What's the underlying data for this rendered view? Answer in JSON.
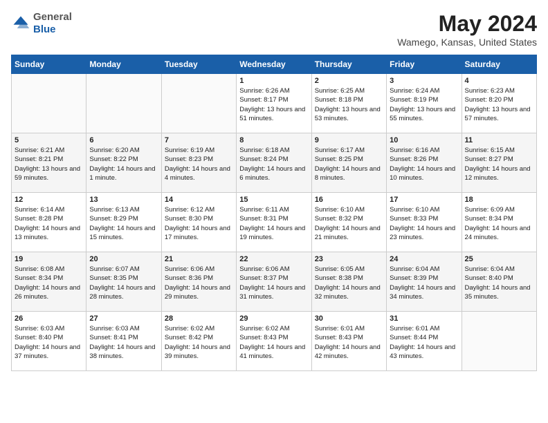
{
  "header": {
    "logo_general": "General",
    "logo_blue": "Blue",
    "month_title": "May 2024",
    "location": "Wamego, Kansas, United States"
  },
  "days_of_week": [
    "Sunday",
    "Monday",
    "Tuesday",
    "Wednesday",
    "Thursday",
    "Friday",
    "Saturday"
  ],
  "weeks": [
    [
      {
        "day": "",
        "sunrise": "",
        "sunset": "",
        "daylight": ""
      },
      {
        "day": "",
        "sunrise": "",
        "sunset": "",
        "daylight": ""
      },
      {
        "day": "",
        "sunrise": "",
        "sunset": "",
        "daylight": ""
      },
      {
        "day": "1",
        "sunrise": "Sunrise: 6:26 AM",
        "sunset": "Sunset: 8:17 PM",
        "daylight": "Daylight: 13 hours and 51 minutes."
      },
      {
        "day": "2",
        "sunrise": "Sunrise: 6:25 AM",
        "sunset": "Sunset: 8:18 PM",
        "daylight": "Daylight: 13 hours and 53 minutes."
      },
      {
        "day": "3",
        "sunrise": "Sunrise: 6:24 AM",
        "sunset": "Sunset: 8:19 PM",
        "daylight": "Daylight: 13 hours and 55 minutes."
      },
      {
        "day": "4",
        "sunrise": "Sunrise: 6:23 AM",
        "sunset": "Sunset: 8:20 PM",
        "daylight": "Daylight: 13 hours and 57 minutes."
      }
    ],
    [
      {
        "day": "5",
        "sunrise": "Sunrise: 6:21 AM",
        "sunset": "Sunset: 8:21 PM",
        "daylight": "Daylight: 13 hours and 59 minutes."
      },
      {
        "day": "6",
        "sunrise": "Sunrise: 6:20 AM",
        "sunset": "Sunset: 8:22 PM",
        "daylight": "Daylight: 14 hours and 1 minute."
      },
      {
        "day": "7",
        "sunrise": "Sunrise: 6:19 AM",
        "sunset": "Sunset: 8:23 PM",
        "daylight": "Daylight: 14 hours and 4 minutes."
      },
      {
        "day": "8",
        "sunrise": "Sunrise: 6:18 AM",
        "sunset": "Sunset: 8:24 PM",
        "daylight": "Daylight: 14 hours and 6 minutes."
      },
      {
        "day": "9",
        "sunrise": "Sunrise: 6:17 AM",
        "sunset": "Sunset: 8:25 PM",
        "daylight": "Daylight: 14 hours and 8 minutes."
      },
      {
        "day": "10",
        "sunrise": "Sunrise: 6:16 AM",
        "sunset": "Sunset: 8:26 PM",
        "daylight": "Daylight: 14 hours and 10 minutes."
      },
      {
        "day": "11",
        "sunrise": "Sunrise: 6:15 AM",
        "sunset": "Sunset: 8:27 PM",
        "daylight": "Daylight: 14 hours and 12 minutes."
      }
    ],
    [
      {
        "day": "12",
        "sunrise": "Sunrise: 6:14 AM",
        "sunset": "Sunset: 8:28 PM",
        "daylight": "Daylight: 14 hours and 13 minutes."
      },
      {
        "day": "13",
        "sunrise": "Sunrise: 6:13 AM",
        "sunset": "Sunset: 8:29 PM",
        "daylight": "Daylight: 14 hours and 15 minutes."
      },
      {
        "day": "14",
        "sunrise": "Sunrise: 6:12 AM",
        "sunset": "Sunset: 8:30 PM",
        "daylight": "Daylight: 14 hours and 17 minutes."
      },
      {
        "day": "15",
        "sunrise": "Sunrise: 6:11 AM",
        "sunset": "Sunset: 8:31 PM",
        "daylight": "Daylight: 14 hours and 19 minutes."
      },
      {
        "day": "16",
        "sunrise": "Sunrise: 6:10 AM",
        "sunset": "Sunset: 8:32 PM",
        "daylight": "Daylight: 14 hours and 21 minutes."
      },
      {
        "day": "17",
        "sunrise": "Sunrise: 6:10 AM",
        "sunset": "Sunset: 8:33 PM",
        "daylight": "Daylight: 14 hours and 23 minutes."
      },
      {
        "day": "18",
        "sunrise": "Sunrise: 6:09 AM",
        "sunset": "Sunset: 8:34 PM",
        "daylight": "Daylight: 14 hours and 24 minutes."
      }
    ],
    [
      {
        "day": "19",
        "sunrise": "Sunrise: 6:08 AM",
        "sunset": "Sunset: 8:34 PM",
        "daylight": "Daylight: 14 hours and 26 minutes."
      },
      {
        "day": "20",
        "sunrise": "Sunrise: 6:07 AM",
        "sunset": "Sunset: 8:35 PM",
        "daylight": "Daylight: 14 hours and 28 minutes."
      },
      {
        "day": "21",
        "sunrise": "Sunrise: 6:06 AM",
        "sunset": "Sunset: 8:36 PM",
        "daylight": "Daylight: 14 hours and 29 minutes."
      },
      {
        "day": "22",
        "sunrise": "Sunrise: 6:06 AM",
        "sunset": "Sunset: 8:37 PM",
        "daylight": "Daylight: 14 hours and 31 minutes."
      },
      {
        "day": "23",
        "sunrise": "Sunrise: 6:05 AM",
        "sunset": "Sunset: 8:38 PM",
        "daylight": "Daylight: 14 hours and 32 minutes."
      },
      {
        "day": "24",
        "sunrise": "Sunrise: 6:04 AM",
        "sunset": "Sunset: 8:39 PM",
        "daylight": "Daylight: 14 hours and 34 minutes."
      },
      {
        "day": "25",
        "sunrise": "Sunrise: 6:04 AM",
        "sunset": "Sunset: 8:40 PM",
        "daylight": "Daylight: 14 hours and 35 minutes."
      }
    ],
    [
      {
        "day": "26",
        "sunrise": "Sunrise: 6:03 AM",
        "sunset": "Sunset: 8:40 PM",
        "daylight": "Daylight: 14 hours and 37 minutes."
      },
      {
        "day": "27",
        "sunrise": "Sunrise: 6:03 AM",
        "sunset": "Sunset: 8:41 PM",
        "daylight": "Daylight: 14 hours and 38 minutes."
      },
      {
        "day": "28",
        "sunrise": "Sunrise: 6:02 AM",
        "sunset": "Sunset: 8:42 PM",
        "daylight": "Daylight: 14 hours and 39 minutes."
      },
      {
        "day": "29",
        "sunrise": "Sunrise: 6:02 AM",
        "sunset": "Sunset: 8:43 PM",
        "daylight": "Daylight: 14 hours and 41 minutes."
      },
      {
        "day": "30",
        "sunrise": "Sunrise: 6:01 AM",
        "sunset": "Sunset: 8:43 PM",
        "daylight": "Daylight: 14 hours and 42 minutes."
      },
      {
        "day": "31",
        "sunrise": "Sunrise: 6:01 AM",
        "sunset": "Sunset: 8:44 PM",
        "daylight": "Daylight: 14 hours and 43 minutes."
      },
      {
        "day": "",
        "sunrise": "",
        "sunset": "",
        "daylight": ""
      }
    ]
  ]
}
